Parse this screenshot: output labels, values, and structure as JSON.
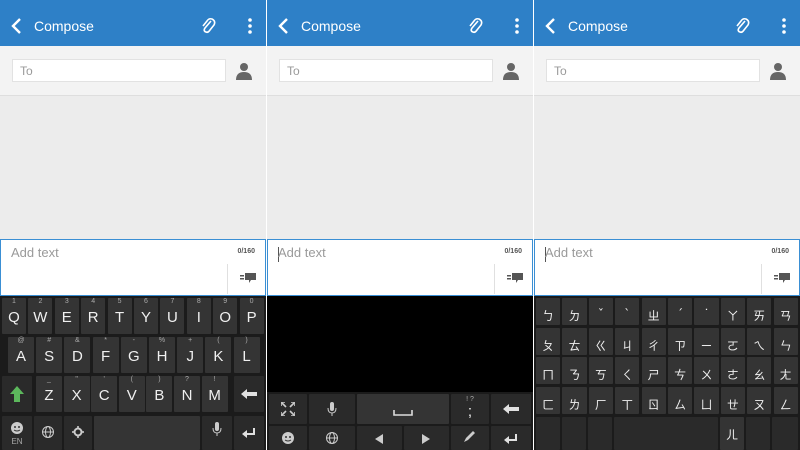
{
  "panels": [
    {
      "app_title": "Compose",
      "to_placeholder": "To",
      "compose_placeholder": "Add text",
      "counter": "0/160",
      "keyboard": {
        "row1": [
          {
            "l": "Q",
            "s": "1"
          },
          {
            "l": "W",
            "s": "2"
          },
          {
            "l": "E",
            "s": "3"
          },
          {
            "l": "R",
            "s": "4"
          },
          {
            "l": "T",
            "s": "5"
          },
          {
            "l": "Y",
            "s": "6"
          },
          {
            "l": "U",
            "s": "7"
          },
          {
            "l": "I",
            "s": "8"
          },
          {
            "l": "O",
            "s": "9"
          },
          {
            "l": "P",
            "s": "0"
          }
        ],
        "row2": [
          {
            "l": "A",
            "s": "@"
          },
          {
            "l": "S",
            "s": "#"
          },
          {
            "l": "D",
            "s": "&"
          },
          {
            "l": "F",
            "s": "*"
          },
          {
            "l": "G",
            "s": "-"
          },
          {
            "l": "H",
            "s": "%"
          },
          {
            "l": "J",
            "s": "+"
          },
          {
            "l": "K",
            "s": "("
          },
          {
            "l": "L",
            "s": ")"
          }
        ],
        "row3": [
          {
            "l": "Z",
            "s": "_"
          },
          {
            "l": "X",
            "s": "\""
          },
          {
            "l": "C",
            "s": "'"
          },
          {
            "l": "V",
            "s": "("
          },
          {
            "l": "B",
            "s": ")"
          },
          {
            "l": "N",
            "s": "?"
          },
          {
            "l": "M",
            "s": "!"
          }
        ],
        "lang_label": "EN"
      }
    },
    {
      "app_title": "Compose",
      "to_placeholder": "To",
      "compose_placeholder": "Add text",
      "counter": "0/160",
      "keyboard": {
        "punct_sub": "! ?",
        "punct_main": ";"
      }
    },
    {
      "app_title": "Compose",
      "to_placeholder": "To",
      "compose_placeholder": "Add text",
      "counter": "0/160",
      "keyboard": {
        "row1": [
          "ㄅ",
          "ㄉ",
          "ˇ",
          "ˋ",
          "ㄓ",
          "ˊ",
          "˙",
          "ㄚ",
          "ㄞ",
          "ㄢ"
        ],
        "row2": [
          "ㄆ",
          "ㄊ",
          "ㄍ",
          "ㄐ",
          "ㄔ",
          "ㄗ",
          "ㄧ",
          "ㄛ",
          "ㄟ",
          "ㄣ"
        ],
        "row3": [
          "ㄇ",
          "ㄋ",
          "ㄎ",
          "ㄑ",
          "ㄕ",
          "ㄘ",
          "ㄨ",
          "ㄜ",
          "ㄠ",
          "ㄤ"
        ],
        "row4": [
          "ㄈ",
          "ㄌ",
          "ㄏ",
          "ㄒ",
          "ㄖ",
          "ㄙ",
          "ㄩ",
          "ㄝ",
          "ㄡ",
          "ㄥ"
        ],
        "bottom": [
          "ㄦ"
        ]
      }
    }
  ]
}
